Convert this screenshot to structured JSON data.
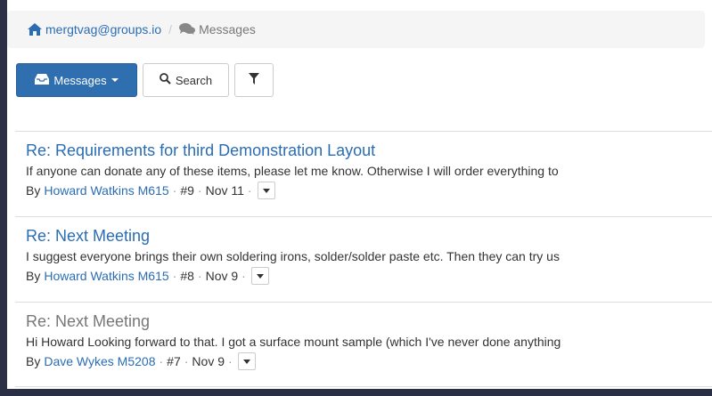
{
  "breadcrumb": {
    "group": "mergtvag@groups.io",
    "separator": "/",
    "current": "Messages"
  },
  "toolbar": {
    "messages_label": "Messages",
    "search_label": "Search"
  },
  "messages": [
    {
      "subject": "Re: Requirements for third Demonstration Layout",
      "snippet": "If anyone can donate any of these items, please let me know. Otherwise I will order everything to",
      "by": "By",
      "author": "Howard Watkins M615",
      "number": "#9",
      "date": "Nov 11",
      "read": false
    },
    {
      "subject": "Re: Next Meeting",
      "snippet": "I suggest everyone brings their own soldering irons, solder/solder paste etc. Then they can try us",
      "by": "By",
      "author": "Howard Watkins M615",
      "number": "#8",
      "date": "Nov 9",
      "read": false
    },
    {
      "subject": "Re: Next Meeting",
      "snippet": "Hi Howard Looking forward to that. I got a surface mount sample (which I've never done anything",
      "by": "By",
      "author": "Dave Wykes M5208",
      "number": "#7",
      "date": "Nov 9",
      "read": true
    }
  ],
  "icons": {
    "home": "home-icon",
    "messages": "comments-icon",
    "inbox": "inbox-icon",
    "search": "search-icon",
    "filter": "filter-icon",
    "dropdown": "caret-down-icon"
  },
  "colors": {
    "link": "#2a6db5",
    "primary": "#2f6fb0",
    "read_subject": "#777777"
  }
}
